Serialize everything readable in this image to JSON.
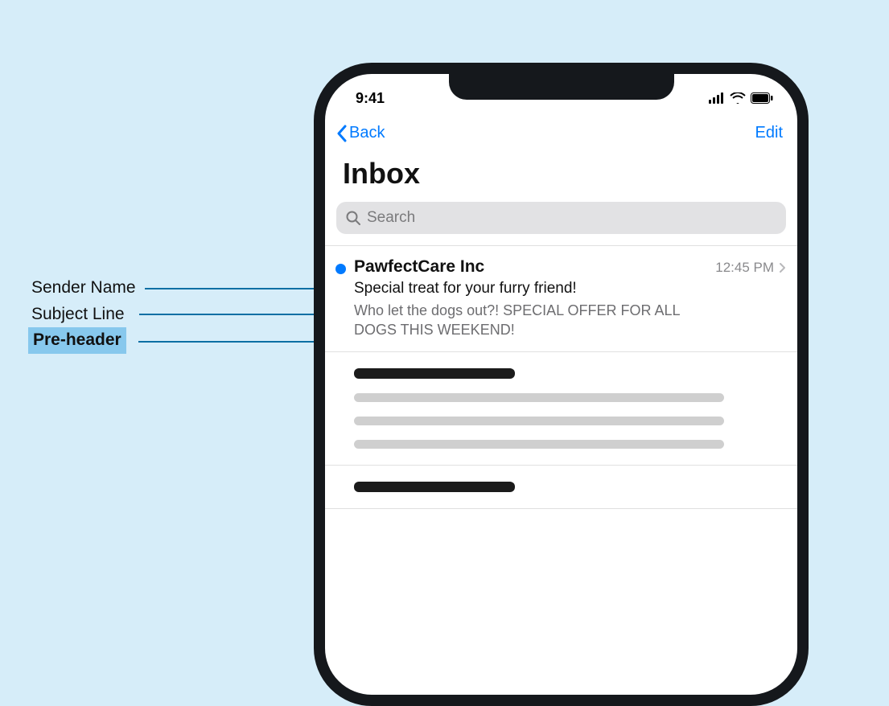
{
  "annotations": {
    "sender": "Sender Name",
    "subject": "Subject Line",
    "preheader": "Pre-header"
  },
  "status": {
    "time": "9:41"
  },
  "nav": {
    "back": "Back",
    "edit": "Edit"
  },
  "title": "Inbox",
  "search": {
    "placeholder": "Search"
  },
  "email": {
    "sender": "PawfectCare Inc",
    "time": "12:45 PM",
    "subject": "Special treat for your furry friend!",
    "preheader": "Who let the dogs out?! SPECIAL OFFER FOR ALL DOGS THIS WEEKEND!"
  }
}
